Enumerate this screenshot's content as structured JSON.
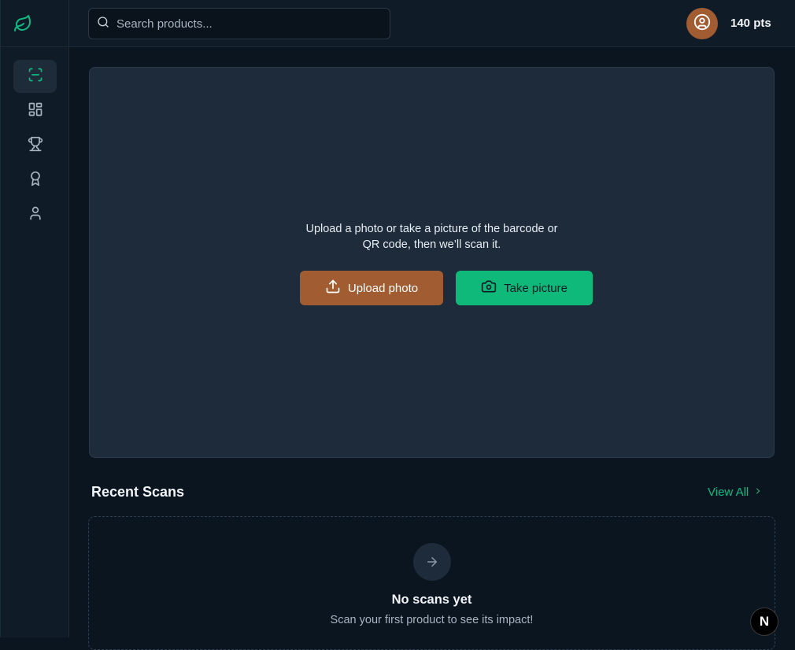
{
  "sidebar": {
    "logo_icon": "leaf-icon",
    "items": [
      {
        "icon": "scan-icon",
        "active": true
      },
      {
        "icon": "dashboard-grid-icon",
        "active": false
      },
      {
        "icon": "trophy-icon",
        "active": false
      },
      {
        "icon": "award-icon",
        "active": false
      },
      {
        "icon": "user-icon",
        "active": false
      }
    ]
  },
  "header": {
    "search_placeholder": "Search products...",
    "avatar_icon": "user-circle-icon",
    "points": "140 pts"
  },
  "scan": {
    "instruction_line1": "Upload a photo or take a picture of the barcode or",
    "instruction_line2": "QR code, then we’ll scan it.",
    "upload_label": "Upload photo",
    "camera_label": "Take picture"
  },
  "recent": {
    "title": "Recent Scans",
    "view_all": "View All",
    "empty_icon": "arrow-right-icon",
    "empty_title": "No scans yet",
    "empty_subtitle": "Scan your first product to see its impact!"
  },
  "badge": {
    "label": "N"
  },
  "colors": {
    "accent": "#10b981",
    "brand_orange": "#a15c32",
    "background": "#0b1520",
    "panel": "#1e2b3a"
  }
}
